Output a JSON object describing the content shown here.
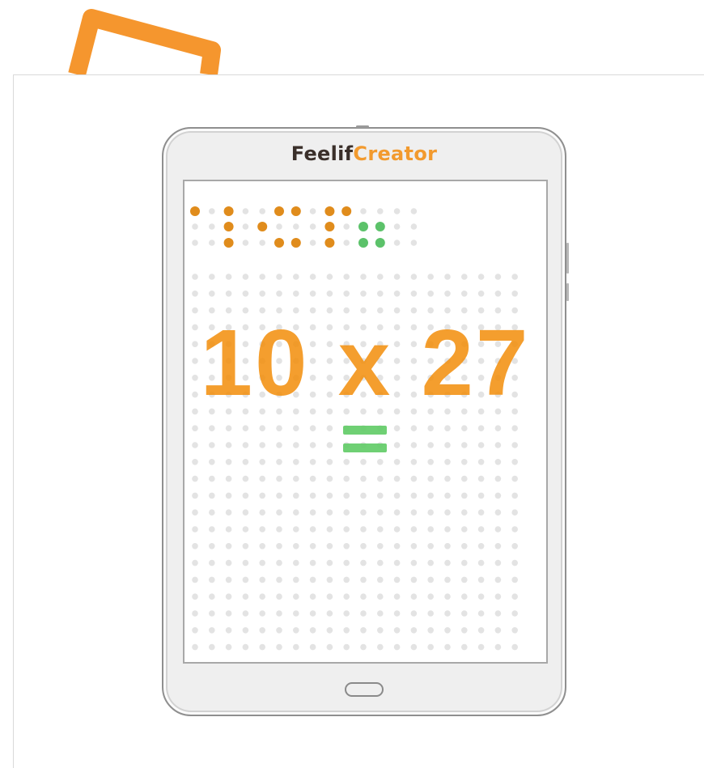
{
  "brand": {
    "part1": "Feelif",
    "part2": "Creator"
  },
  "display": {
    "expression": "10 x 27",
    "equals_symbol": "="
  },
  "colors": {
    "accent": "#f29a2e",
    "braille_orange": "#e08c1c",
    "braille_green": "#5cc26a",
    "dot_inactive": "#e3e3e3",
    "equals_green": "#63cc68"
  },
  "braille_cells": [
    {
      "symbol": "number-sign",
      "color": "orange",
      "dots": [
        1
      ]
    },
    {
      "symbol": "1",
      "color": "orange",
      "dots": [
        1,
        2,
        3
      ]
    },
    {
      "symbol": "0",
      "color": "orange",
      "dots": [
        2,
        4,
        6
      ]
    },
    {
      "symbol": "x",
      "color": "orange",
      "dots": [
        1,
        3
      ]
    },
    {
      "symbol": "2",
      "color": "orange",
      "dots": [
        1,
        2,
        3,
        4
      ]
    },
    {
      "symbol": "7",
      "color": "green",
      "dots": [
        2,
        3,
        5,
        6
      ]
    },
    {
      "symbol": "7-continued",
      "color": "none",
      "dots": []
    }
  ]
}
